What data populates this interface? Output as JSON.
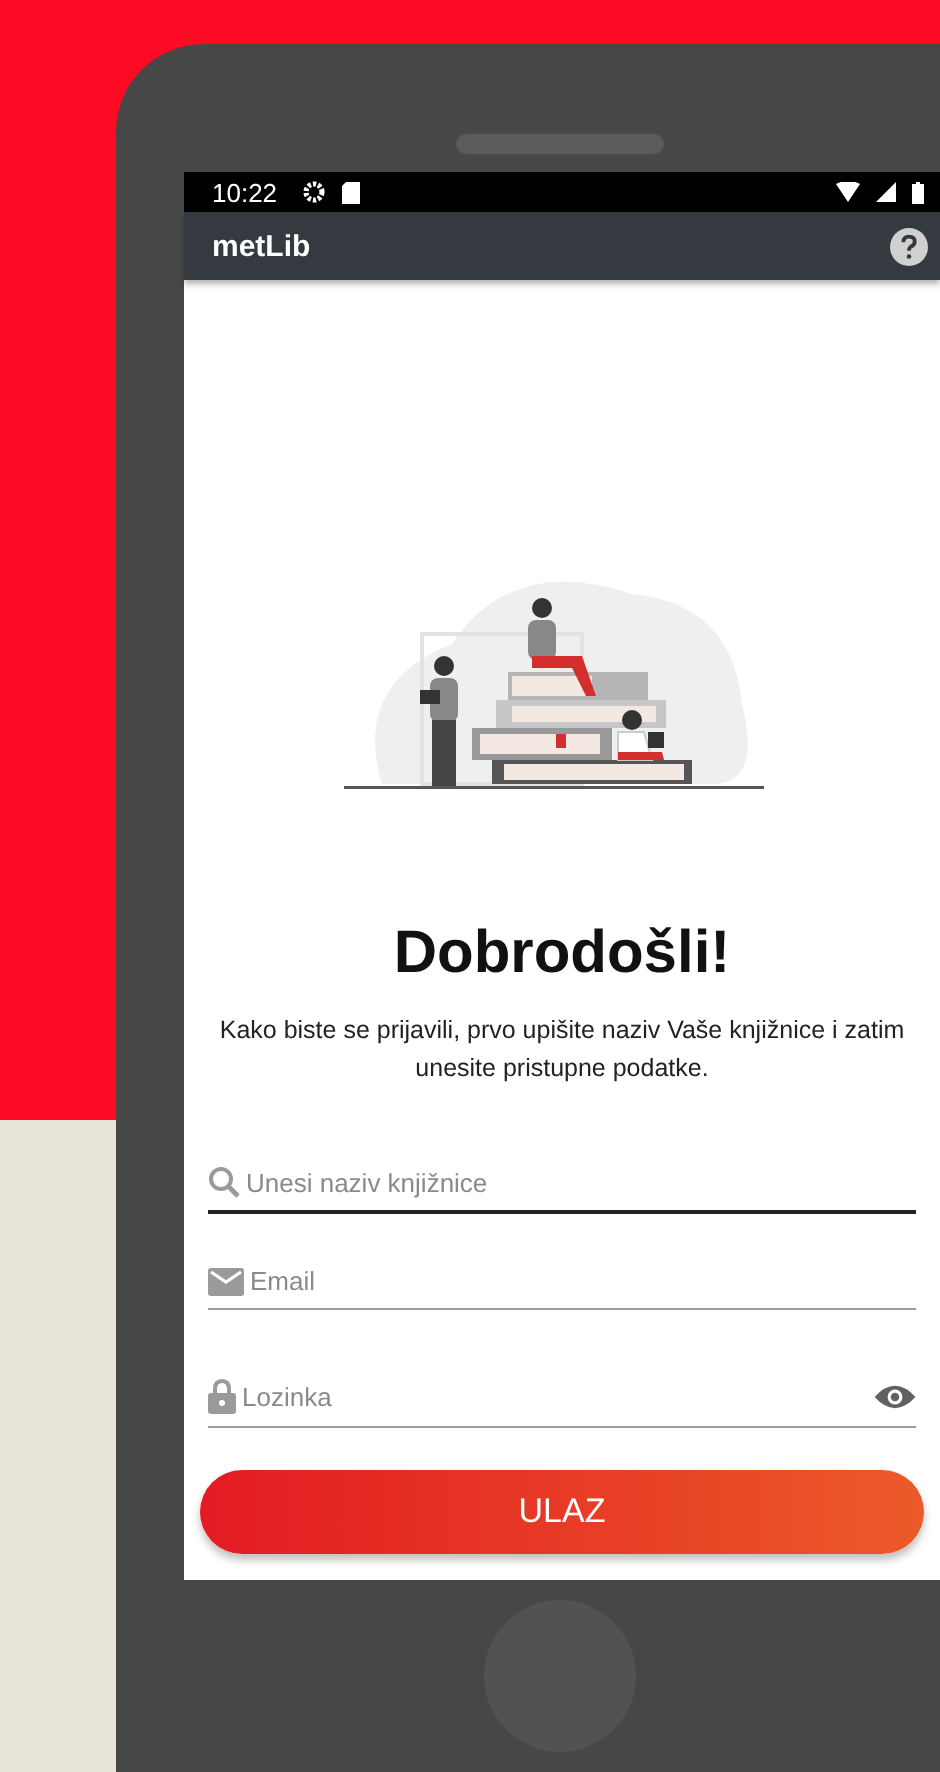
{
  "status_bar": {
    "time": "10:22"
  },
  "app_bar": {
    "title": "metLib"
  },
  "welcome": {
    "heading": "Dobrodošli!",
    "description": "Kako biste se prijavili, prvo upišite naziv Vaše knjižnice i zatim unesite pristupne podatke."
  },
  "fields": [
    {
      "kind": "search",
      "placeholder": "Unesi naziv knjižnice",
      "focused": true
    },
    {
      "kind": "email",
      "placeholder": "Email",
      "focused": false
    },
    {
      "kind": "password",
      "placeholder": "Lozinka",
      "focused": false
    }
  ],
  "login_button": {
    "label": "ULAZ"
  }
}
